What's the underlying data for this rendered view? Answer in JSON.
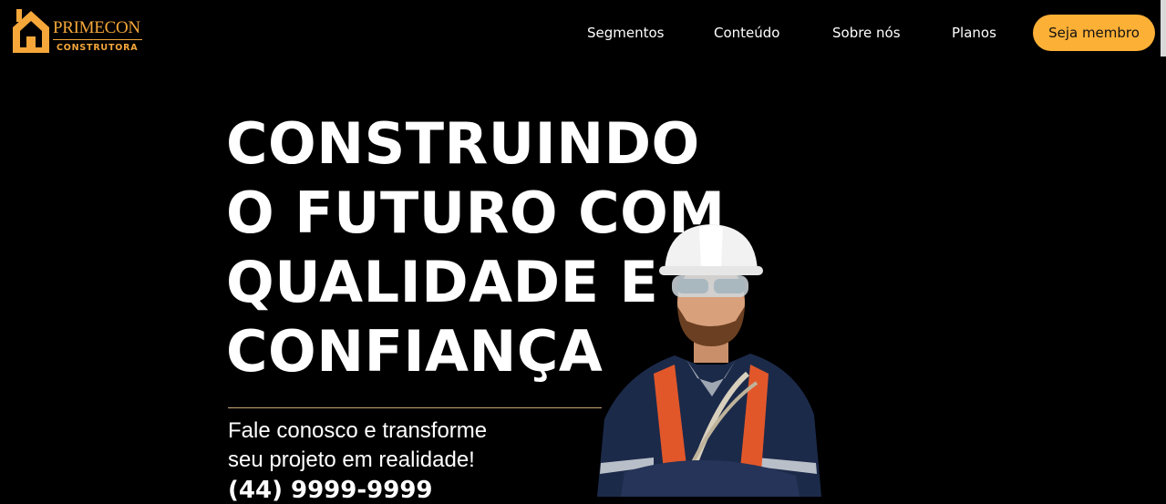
{
  "brand": {
    "name": "PRIMECON",
    "subtitle": "CONSTRUTORA",
    "accent_color": "#fdb036"
  },
  "nav": {
    "items": [
      "Segmentos",
      "Conteúdo",
      "Sobre nós",
      "Planos"
    ],
    "cta_label": "Seja membro"
  },
  "hero": {
    "headline_lines": [
      "CONSTRUINDO",
      "O FUTURO COM",
      "QUALIDADE E",
      "CONFIANÇA"
    ],
    "subtext_lines": [
      "Fale conosco e transforme",
      "seu projeto em realidade!"
    ],
    "phone": "(44) 9999-9999",
    "image": "construction-worker-photo"
  }
}
